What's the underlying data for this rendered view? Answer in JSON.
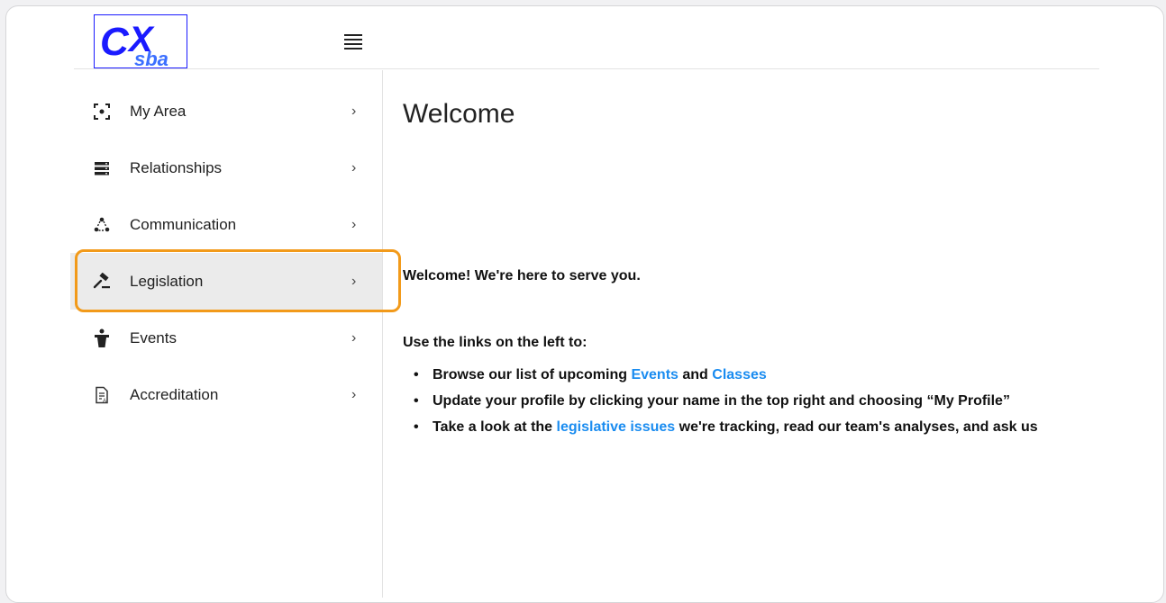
{
  "logo": {
    "text": "CX",
    "subtext": "sba"
  },
  "sidebar": {
    "items": [
      {
        "label": "My Area",
        "icon": "focus-icon"
      },
      {
        "label": "Relationships",
        "icon": "server-icon"
      },
      {
        "label": "Communication",
        "icon": "network-icon"
      },
      {
        "label": "Legislation",
        "icon": "gavel-icon",
        "active": true
      },
      {
        "label": "Events",
        "icon": "speaker-icon"
      },
      {
        "label": "Accreditation",
        "icon": "document-icon"
      }
    ],
    "chevron": "›"
  },
  "main": {
    "title": "Welcome",
    "greeting": "Welcome!  We're here to serve you.",
    "links_intro": "Use the links on the left to:",
    "bullet1": {
      "pre": "Browse our list of upcoming ",
      "link1": "Events",
      "mid": " and ",
      "link2": "Classes"
    },
    "bullet2": {
      "text": "Update your profile by clicking your name in the top right and choosing “My Profile”"
    },
    "bullet3": {
      "pre": "Take a look at the ",
      "link": "legislative issues",
      "post": " we're tracking, read our team's analyses, and ask us"
    }
  },
  "colors": {
    "link": "#1a8cf0",
    "highlight": "#f29a1a",
    "active_bg": "#ebebeb",
    "logo_blue": "#1a1aff"
  }
}
